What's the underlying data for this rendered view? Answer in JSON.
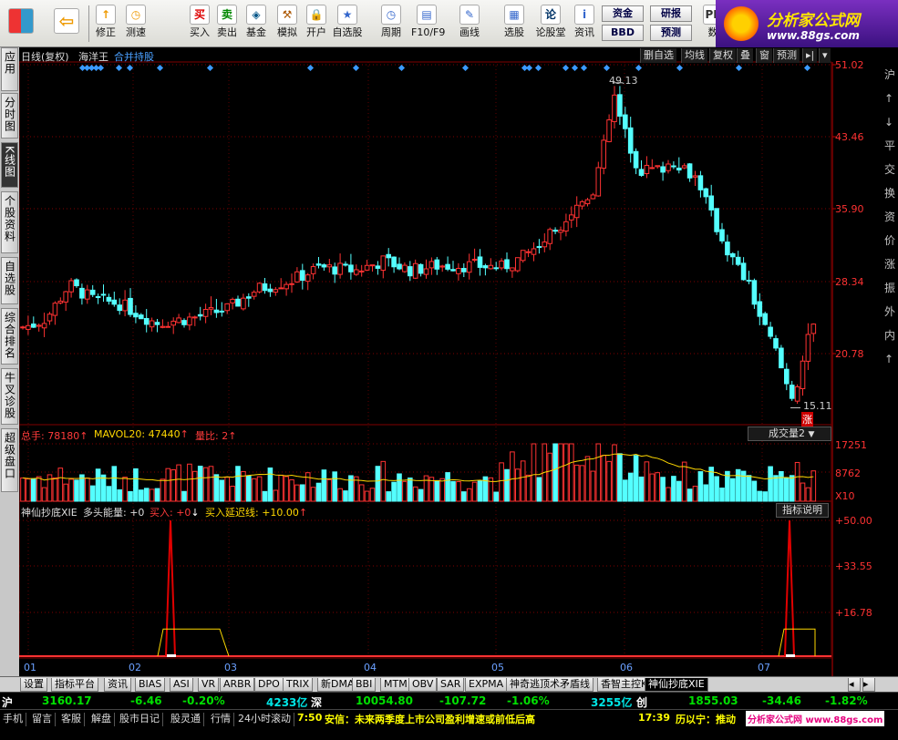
{
  "toolbar": {
    "buttons": [
      {
        "label": "修正",
        "icon": "↑"
      },
      {
        "label": "测速",
        "icon": "◷"
      },
      {
        "label": "买入",
        "icon": "买"
      },
      {
        "label": "卖出",
        "icon": "卖"
      },
      {
        "label": "基金",
        "icon": "◈"
      },
      {
        "label": "模拟",
        "icon": "⚒"
      },
      {
        "label": "开户",
        "icon": "🔒"
      },
      {
        "label": "自选股",
        "icon": "★"
      },
      {
        "label": "周期",
        "icon": "◷"
      },
      {
        "label": "F10/F9",
        "icon": "▤"
      },
      {
        "label": "画线",
        "icon": "✎"
      },
      {
        "label": "选股",
        "icon": "▦"
      },
      {
        "label": "论股堂",
        "icon": "论"
      },
      {
        "label": "资讯",
        "icon": "i"
      },
      {
        "label": "数",
        "icon": "PE"
      }
    ],
    "fund_label": "资金",
    "bbd_label": "BBD",
    "research_label": "研报",
    "forecast_label": "预测"
  },
  "logo": {
    "title": "分析家公式网",
    "url": "www.88gs.com"
  },
  "left_tabs": [
    "应用",
    "分时图",
    "K线图",
    "个股资料",
    "自选股",
    "综合排名",
    "牛叉诊股",
    "超级盘口"
  ],
  "chart_header": {
    "period": "日线(复权)",
    "stock": "海洋王",
    "merge": "合并持股"
  },
  "top_menu": [
    "删自选",
    "均线",
    "复权",
    "叠",
    "窗",
    "预测"
  ],
  "right_edge_chars": [
    "沪",
    "↑",
    "↓",
    "平",
    "交",
    "换",
    "资",
    "价",
    "涨",
    "振",
    "外",
    "内",
    "↑"
  ],
  "price_axis": [
    "51.02",
    "43.46",
    "35.90",
    "28.34",
    "20.78"
  ],
  "price_annotations": {
    "high": "49.13",
    "low": "15.11",
    "low_mark": "涨"
  },
  "volume_header": {
    "total": "总手: 78180",
    "total_arrow": "↑",
    "mavol": "MAVOL20: 47440",
    "mavol_arrow": "↑",
    "ratio": "量比: 2",
    "ratio_arrow": "↑",
    "button": "成交量2"
  },
  "volume_axis": [
    "17251",
    "8762",
    "X10"
  ],
  "indicator_header": {
    "name": "神仙抄底XIE",
    "a": "多头能量: +0",
    "b": "买入: +0",
    "b_arrow": "↓",
    "c": "买入延迟线: +10.00",
    "c_arrow": "↑",
    "button": "指标说明"
  },
  "indicator_axis": [
    "+50.00",
    "+33.55",
    "+16.78"
  ],
  "x_labels": [
    "01",
    "02",
    "03",
    "04",
    "05",
    "06",
    "07"
  ],
  "bottom_tabs": [
    "设置",
    "指标平台",
    "资讯",
    "BIAS",
    "ASI",
    "VR",
    "ARBR",
    "DPO",
    "TRIX",
    "新DMA",
    "BBI",
    "MTM",
    "OBV",
    "SAR",
    "EXPMA",
    "神奇逃顶术矛盾线",
    "香智主控K线",
    "神仙抄底XIE"
  ],
  "ticker": {
    "sh": "沪",
    "sh_index": "3160.17",
    "sh_chg": "-6.46",
    "sh_pct": "-0.20%",
    "sh_amt": "4233亿",
    "sz": "深",
    "sz_index": "10054.80",
    "sz_chg": "-107.72",
    "sz_pct": "-1.06%",
    "sz_amt": "3255亿",
    "cy": "创",
    "cy_index": "1855.03",
    "cy_chg": "-34.46",
    "cy_pct": "-1.82%"
  },
  "status": {
    "items": [
      "手机",
      "留言",
      "客服",
      "解盘",
      "股市日记",
      "股灵通",
      "行情",
      "24小时滚动"
    ],
    "news_time": "7:50",
    "news": "安信：未来两季度上市公司盈利增速或前低后高",
    "time2": "17:39",
    "news2": "历以宁：推动",
    "watermark": "分析家公式网 www.88gs.com"
  },
  "chart_data": {
    "type": "candlestick",
    "note_levels": {
      "price_ylim": [
        15.11,
        51.02
      ],
      "volume_ylim": [
        0,
        17251
      ],
      "indicator_ylim": [
        0,
        50
      ]
    },
    "x_month_labels": [
      "01",
      "02",
      "03",
      "04",
      "05",
      "06",
      "07"
    ],
    "price_high": 49.13,
    "price_low": 15.11,
    "indicator_peaks": [
      {
        "month": "02",
        "value": 50
      },
      {
        "month": "07",
        "value": 50
      }
    ]
  }
}
